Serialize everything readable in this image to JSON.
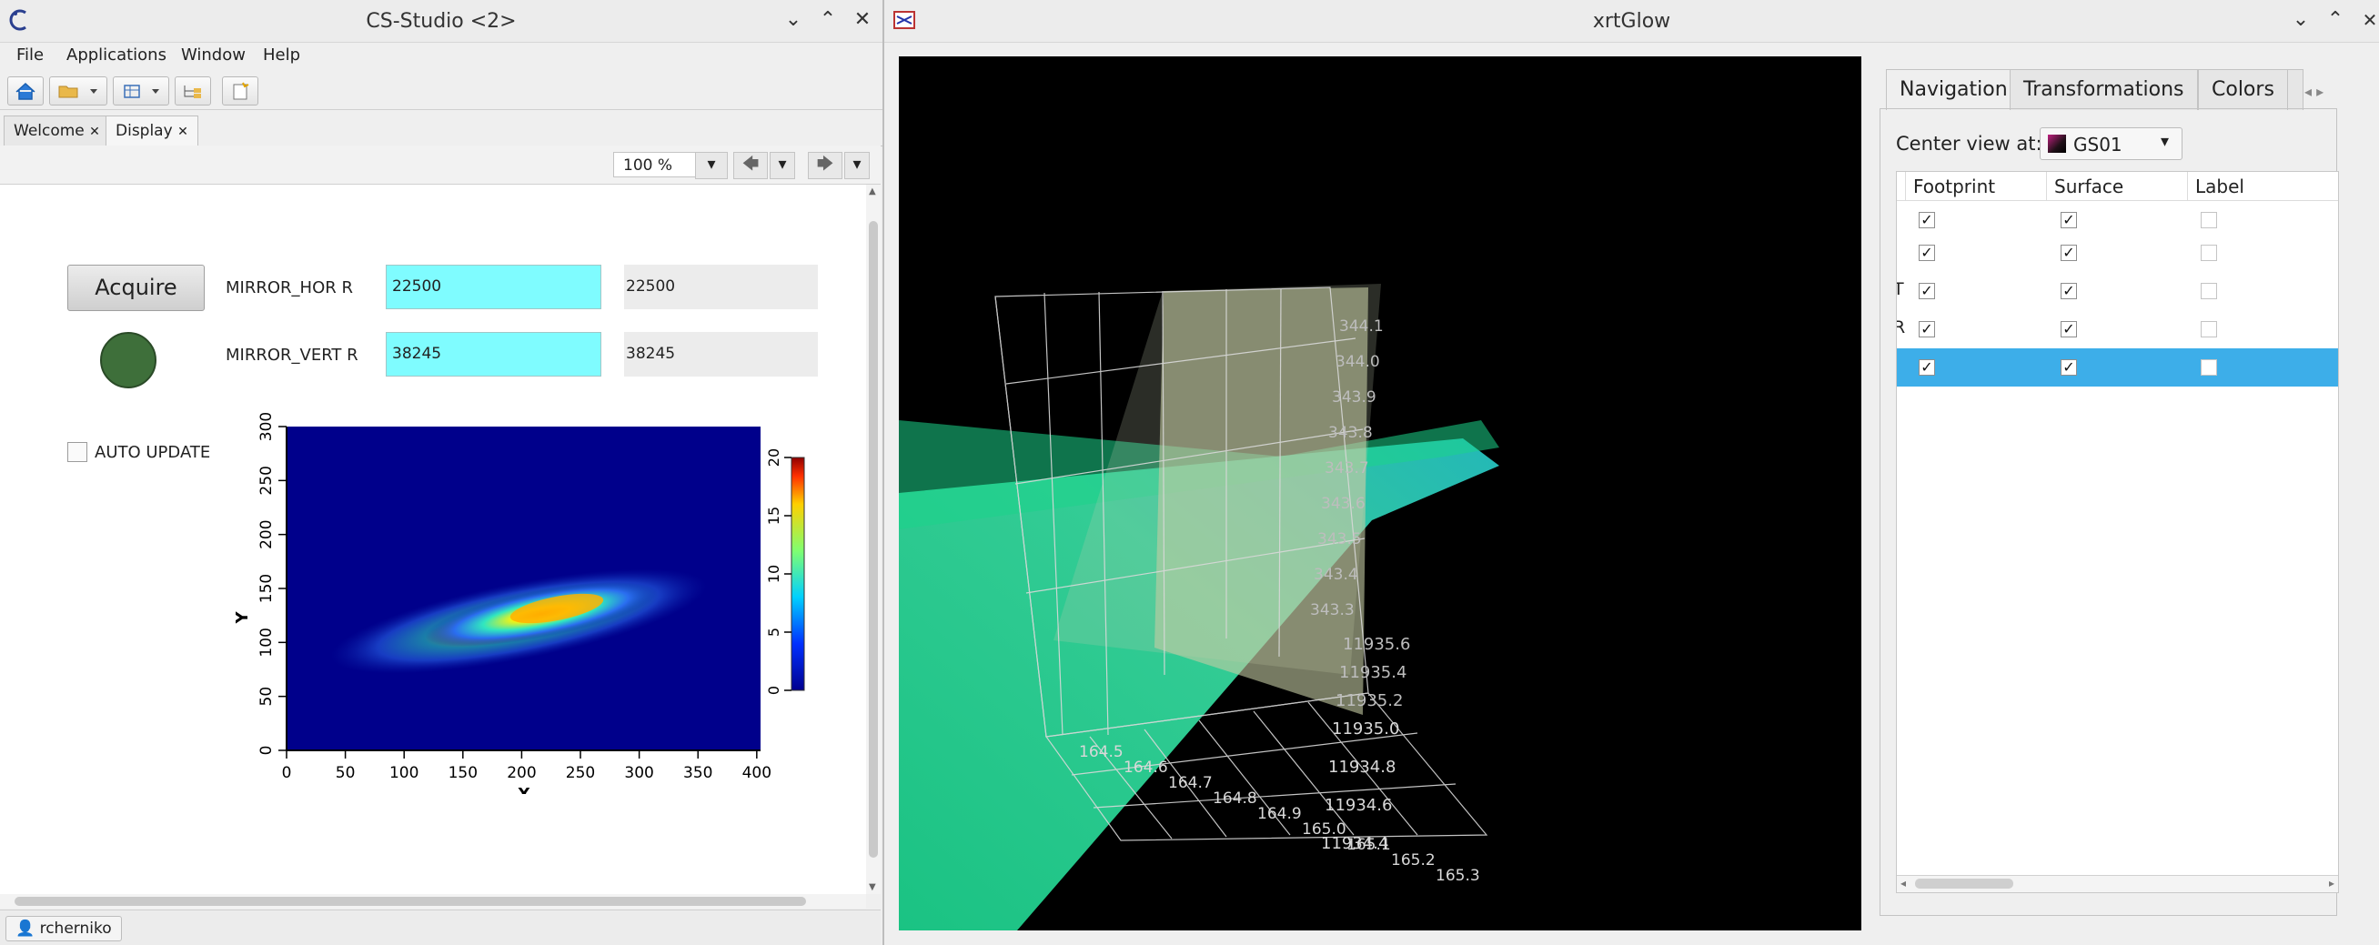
{
  "cs_window": {
    "title": "CS-Studio <2>",
    "menu": [
      "File",
      "Applications",
      "Window",
      "Help"
    ],
    "tabs": [
      {
        "label": "Welcome",
        "close": "✕"
      },
      {
        "label": "Display",
        "close": "✕"
      }
    ],
    "zoom": "100 %",
    "display": {
      "acquire_label": "Acquire",
      "fields": [
        {
          "label": "MIRROR_HOR R",
          "value": "22500",
          "readback": "22500"
        },
        {
          "label": "MIRROR_VERT R",
          "value": "38245",
          "readback": "38245"
        }
      ],
      "auto_update_label": "AUTO UPDATE",
      "plot": {
        "xlabel": "X",
        "ylabel": "Y",
        "xticks": [
          "0",
          "50",
          "100",
          "150",
          "200",
          "250",
          "300",
          "350",
          "400"
        ],
        "yticks": [
          "0",
          "50",
          "100",
          "150",
          "200",
          "250",
          "300"
        ],
        "colorbar_ticks": [
          "0",
          "5",
          "10",
          "15",
          "20"
        ]
      }
    },
    "status_user": "rcherniko"
  },
  "xrt_window": {
    "title": "xrtGlow",
    "tabs": [
      "Navigation",
      "Transformations",
      "Colors"
    ],
    "center_view_label": "Center view at:",
    "center_view_value": "GS01",
    "table": {
      "headers": [
        "Footprint",
        "Surface",
        "Label"
      ],
      "row_label_fragments": [
        "",
        "",
        "T",
        "R",
        ""
      ],
      "rows": [
        {
          "footprint": true,
          "surface": true,
          "label": false,
          "selected": false
        },
        {
          "footprint": true,
          "surface": true,
          "label": false,
          "selected": false
        },
        {
          "footprint": true,
          "surface": true,
          "label": false,
          "selected": false
        },
        {
          "footprint": true,
          "surface": true,
          "label": false,
          "selected": false
        },
        {
          "footprint": true,
          "surface": true,
          "label": false,
          "selected": true
        }
      ]
    },
    "axis_labels": {
      "z_right": [
        "344.1",
        "344.0",
        "343.9",
        "343.8",
        "343.7",
        "343.6",
        "343.5",
        "343.4",
        "343.3"
      ],
      "y_right": [
        "11935.6",
        "11935.4",
        "11935.2",
        "11935.0",
        "11934.8",
        "11934.6",
        "11934.4"
      ],
      "x_bottom": [
        "164.5",
        "164.6",
        "164.7",
        "164.8",
        "164.9",
        "165.0",
        "165.1",
        "165.2",
        "165.3"
      ]
    }
  },
  "colors": {
    "selected_row": "#3daee9",
    "input_cyan": "#7ffcff",
    "led": "#3e6f3a"
  }
}
